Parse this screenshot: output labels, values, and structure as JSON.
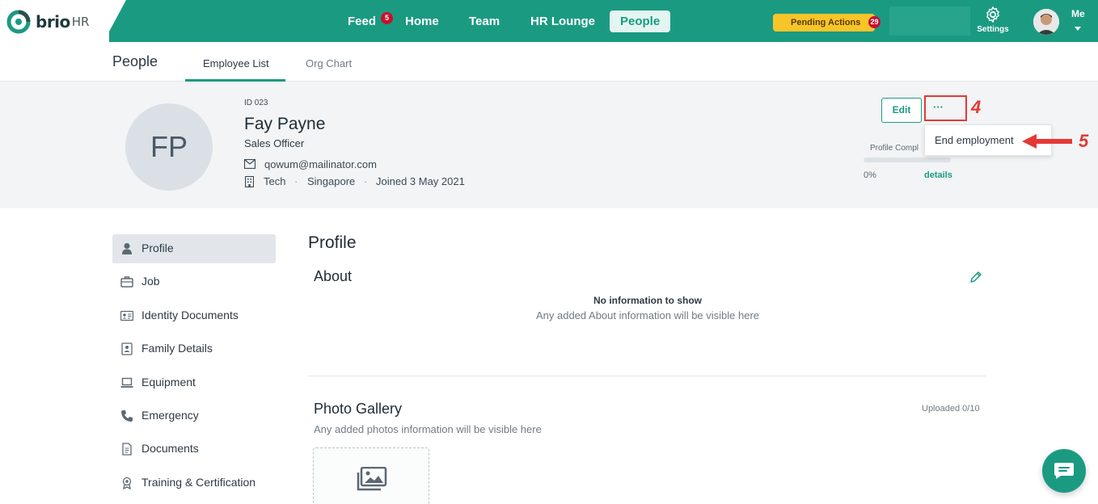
{
  "brand": {
    "name": "brio",
    "suffix": "HR"
  },
  "topnav": {
    "items": [
      {
        "label": "Feed",
        "badge": "5"
      },
      {
        "label": "Home"
      },
      {
        "label": "Team"
      },
      {
        "label": "HR Lounge"
      },
      {
        "label": "People",
        "active": true
      }
    ],
    "pending_label": "Pending Actions",
    "pending_count": "29",
    "settings_label": "Settings",
    "me_label": "Me"
  },
  "subnav": {
    "title": "People",
    "tabs": [
      {
        "label": "Employee List",
        "active": true
      },
      {
        "label": "Org Chart"
      }
    ]
  },
  "employee": {
    "initials": "FP",
    "id": "ID 023",
    "name": "Fay Payne",
    "title": "Sales Officer",
    "email": "qowum@mailinator.com",
    "department": "Tech",
    "location": "Singapore",
    "joined": "Joined 3 May 2021"
  },
  "actions": {
    "edit_label": "Edit",
    "more_label": "···",
    "dropdown_item": "End employment",
    "annotation_4": "4",
    "annotation_5": "5"
  },
  "completion": {
    "label": "Profile Compl",
    "value_text": "0%",
    "value": 0,
    "details_label": "details"
  },
  "sidebar": {
    "items": [
      {
        "label": "Profile",
        "icon": "person-icon",
        "active": true
      },
      {
        "label": "Job",
        "icon": "briefcase-icon"
      },
      {
        "label": "Identity Documents",
        "icon": "id-card-icon"
      },
      {
        "label": "Family Details",
        "icon": "family-icon"
      },
      {
        "label": "Equipment",
        "icon": "laptop-icon"
      },
      {
        "label": "Emergency",
        "icon": "phone-icon"
      },
      {
        "label": "Documents",
        "icon": "document-icon"
      },
      {
        "label": "Training & Certification",
        "icon": "certificate-icon"
      }
    ]
  },
  "main": {
    "title": "Profile",
    "about": {
      "title": "About",
      "empty_title": "No information to show",
      "empty_sub": "Any added About information will be visible here"
    },
    "gallery": {
      "title": "Photo Gallery",
      "uploaded": "Uploaded 0/10",
      "sub": "Any added photos information will be visible here"
    }
  },
  "colors": {
    "brand": "#1b9a82",
    "annotation": "#e53935",
    "pending": "#f7c52a",
    "badge": "#c8102e"
  }
}
